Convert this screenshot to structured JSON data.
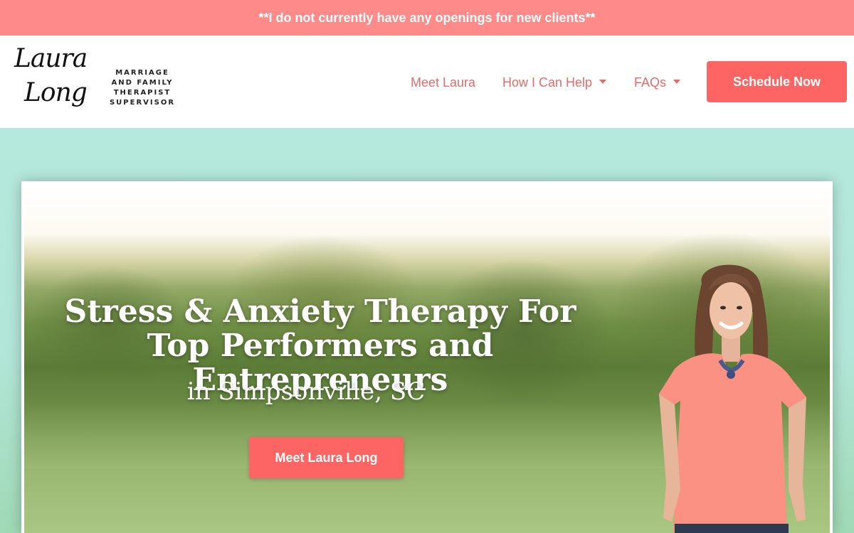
{
  "announcement": "**I do not currently have any openings for new clients**",
  "logo": {
    "script_line1": "Laura",
    "script_line2": "Long",
    "tagline": "Marriage and Family Therapist Supervisor"
  },
  "nav": {
    "items": [
      {
        "label": "Meet Laura",
        "dropdown": false
      },
      {
        "label": "How I Can Help",
        "dropdown": true
      },
      {
        "label": "FAQs",
        "dropdown": true
      }
    ],
    "cta": "Schedule Now"
  },
  "hero": {
    "headline": "Stress & Anxiety Therapy For Top Performers and Entrepreneurs",
    "subheadline": "in Simpsonville, SC",
    "button": "Meet Laura Long"
  },
  "colors": {
    "announcement_bg": "#fe8a8a",
    "accent": "#fd6464",
    "nav_text": "#e56a6a",
    "hero_bg": "#b5e9dd"
  }
}
